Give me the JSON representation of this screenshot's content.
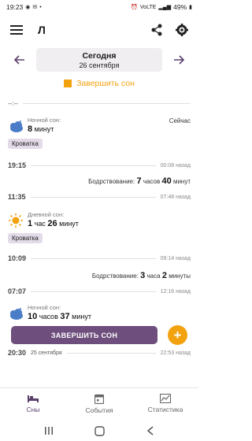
{
  "status_bar": {
    "time": "19:23",
    "network": "VoLTE",
    "battery": "49%"
  },
  "app_bar": {
    "title": "Л"
  },
  "date_nav": {
    "title": "Сегодня",
    "subtitle": "26 сентября"
  },
  "finish_sleep_link": "Завершить сон",
  "top_dash": "--:--",
  "cards": [
    {
      "label": "Ночной сон:",
      "value_main": "8",
      "value_unit": "минут",
      "right": "Сейчас",
      "tag": "Кроватка"
    },
    {
      "label": "Дневной сон:",
      "v1": "1",
      "u1": "час",
      "v2": "26",
      "u2": "минут",
      "tag": "Кроватка"
    },
    {
      "label": "Ночной сон:",
      "v1": "10",
      "u1": "часов",
      "v2": "37",
      "u2": "минут"
    }
  ],
  "time_rows": [
    {
      "time": "19:15",
      "ago": "00:08 назад"
    },
    {
      "time": "11:35",
      "ago": "07:48 назад"
    },
    {
      "time": "10:09",
      "ago": "09:14 назад"
    },
    {
      "time": "07:07",
      "ago": "12:16 назад"
    },
    {
      "time": "20:30",
      "date": "25 сентября",
      "ago": "22:53 назад"
    }
  ],
  "awake_rows": [
    {
      "label": "Бодрствование:",
      "v1": "7",
      "u1": "часов",
      "v2": "40",
      "u2": "минут"
    },
    {
      "label": "Бодрствование:",
      "v1": "3",
      "u1": "часа",
      "v2": "2",
      "u2": "минуты"
    }
  ],
  "finish_button": "ЗАВЕРШИТЬ СОН",
  "fab": "+",
  "bottom_nav": [
    {
      "label": "Сны",
      "icon": "bed-icon"
    },
    {
      "label": "События",
      "icon": "calendar-icon"
    },
    {
      "label": "Статистика",
      "icon": "chart-icon"
    }
  ],
  "colors": {
    "accent": "#f2a20f",
    "primary": "#6d4e7c",
    "tag_bg": "#e3dbe8",
    "date_bg": "#f1eef2"
  }
}
